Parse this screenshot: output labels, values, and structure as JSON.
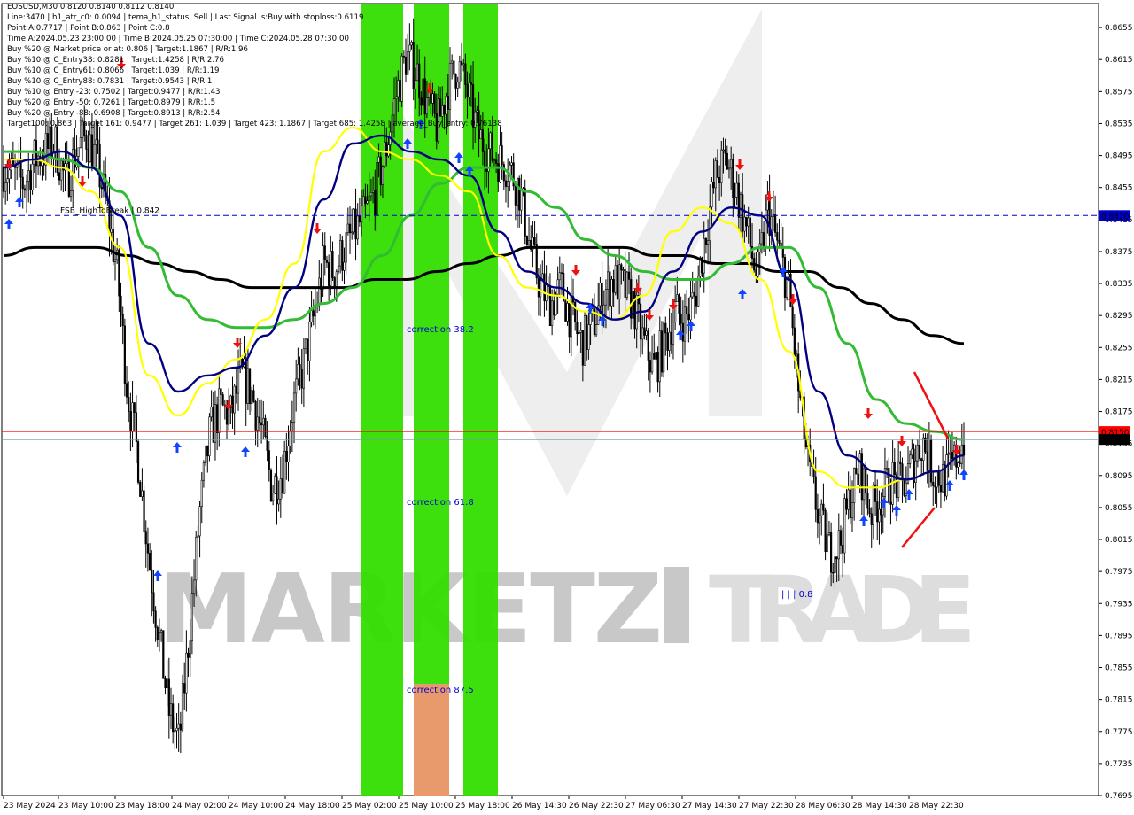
{
  "symbol_line": "EOSUSD,M30  0.8120 0.8140 0.8112 0.8140",
  "info_lines": [
    "Line:3470  |  h1_atr_c0: 0.0094  |  tema_h1_status: Sell  |  Last Signal is:Buy with stoploss:0.6119",
    "Point A:0.7717  |  Point B:0.863  |  Point C:0.8",
    "Time A:2024.05.23 23:00:00  |  Time B:2024.05.25 07:30:00  |  Time C:2024.05.28 07:30:00",
    "Buy %20 @ Market price or at: 0.806  |  Target:1.1867  |  R/R:1.96",
    "Buy %10 @ C_Entry38: 0.8281  |  Target:1.4258  |  R/R:2.76",
    "Buy %10 @ C_Entry61: 0.8066  |  Target:1.039  |  R/R:1.19",
    "Buy %10 @ C_Entry88: 0.7831  |  Target:0.9543  |  R/R:1",
    "Buy %10 @ Entry -23: 0.7502  |  Target:0.9477  |  R/R:1.43",
    "Buy %20 @ Entry -50: 0.7261  |  Target:0.8979  |  R/R:1.5",
    "Buy %20 @ Entry -88: 0.6908  |  Target:0.8913  |  R/R:2.54",
    "Target100: 0.863  |  Target 161: 0.9477  |  Target 261: 1.039  |  Target 423: 1.1867  |  Target 685: 1.4258  |  average_Buy_entry: 0.76138"
  ],
  "fsb_label": "FSB_HighToBreak | 0.842",
  "corrections": [
    "correction 38.2",
    "correction 61.8",
    "correction 87.5"
  ],
  "wave_label": "| | | 0.8",
  "watermark": {
    "left": "MARKETZ",
    "i": "I",
    "right": "TRADE"
  },
  "price_badges": {
    "fsb": "0.8420",
    "red": "0.8150",
    "current": "0.8140"
  },
  "colors": {
    "up": "#000000",
    "down": "#000000",
    "ma_black": "#000000",
    "ma_green": "#33bb33",
    "ma_navy": "#000080",
    "ma_yellow": "#ffff00",
    "fsb_line": "#0000cc",
    "red_line": "#ff0000",
    "band_green": "#33dd00",
    "band_orange": "#e89a6c"
  },
  "chart_data": {
    "type": "candlestick",
    "title": "EOSUSD,M30",
    "y_ticks": [
      "0.8655",
      "0.8615",
      "0.8575",
      "0.8535",
      "0.8495",
      "0.8455",
      "0.8415",
      "0.8375",
      "0.8335",
      "0.8295",
      "0.8255",
      "0.8215",
      "0.8175",
      "0.8135",
      "0.8095",
      "0.8055",
      "0.8015",
      "0.7975",
      "0.7935",
      "0.7895",
      "0.7855",
      "0.7815",
      "0.7775",
      "0.7735",
      "0.7695"
    ],
    "x_ticks": [
      "23 May 2024",
      "23 May 10:00",
      "23 May 18:00",
      "24 May 02:00",
      "24 May 10:00",
      "24 May 18:00",
      "25 May 02:00",
      "25 May 10:00",
      "25 May 18:00",
      "26 May 14:30",
      "26 May 22:30",
      "27 May 06:30",
      "27 May 14:30",
      "27 May 22:30",
      "28 May 06:30",
      "28 May 14:30",
      "28 May 22:30"
    ],
    "ylim": [
      0.7695,
      0.8685
    ],
    "levels": {
      "fsb_high_to_break": 0.842,
      "red_level": 0.815,
      "current": 0.814
    },
    "close_path": [
      0.848,
      0.847,
      0.846,
      0.849,
      0.85,
      0.851,
      0.846,
      0.85,
      0.852,
      0.849,
      0.843,
      0.835,
      0.82,
      0.812,
      0.8,
      0.79,
      0.78,
      0.776,
      0.79,
      0.805,
      0.815,
      0.818,
      0.817,
      0.822,
      0.82,
      0.815,
      0.808,
      0.81,
      0.818,
      0.823,
      0.829,
      0.836,
      0.835,
      0.838,
      0.84,
      0.842,
      0.845,
      0.85,
      0.857,
      0.862,
      0.86,
      0.856,
      0.853,
      0.858,
      0.861,
      0.857,
      0.852,
      0.85,
      0.849,
      0.848,
      0.845,
      0.838,
      0.833,
      0.831,
      0.833,
      0.829,
      0.826,
      0.828,
      0.832,
      0.834,
      0.833,
      0.831,
      0.826,
      0.823,
      0.826,
      0.83,
      0.829,
      0.832,
      0.84,
      0.847,
      0.849,
      0.845,
      0.84,
      0.834,
      0.843,
      0.838,
      0.833,
      0.82,
      0.81,
      0.804,
      0.8,
      0.801,
      0.807,
      0.81,
      0.805,
      0.807,
      0.809,
      0.808,
      0.811,
      0.814,
      0.81,
      0.809,
      0.811,
      0.814
    ],
    "ma_black": [
      0.837,
      0.838,
      0.838,
      0.838,
      0.837,
      0.836,
      0.835,
      0.834,
      0.833,
      0.833,
      0.833,
      0.833,
      0.834,
      0.834,
      0.835,
      0.836,
      0.837,
      0.838,
      0.838,
      0.838,
      0.838,
      0.837,
      0.837,
      0.836,
      0.836,
      0.835,
      0.835,
      0.833,
      0.831,
      0.829,
      0.827,
      0.826
    ],
    "ma_green": [
      0.85,
      0.85,
      0.849,
      0.848,
      0.845,
      0.838,
      0.832,
      0.829,
      0.828,
      0.828,
      0.829,
      0.831,
      0.833,
      0.837,
      0.842,
      0.846,
      0.848,
      0.848,
      0.845,
      0.843,
      0.839,
      0.837,
      0.835,
      0.834,
      0.834,
      0.836,
      0.838,
      0.838,
      0.833,
      0.826,
      0.819,
      0.816,
      0.815,
      0.814
    ],
    "ma_navy": [
      0.848,
      0.849,
      0.85,
      0.848,
      0.842,
      0.826,
      0.82,
      0.822,
      0.823,
      0.827,
      0.833,
      0.844,
      0.851,
      0.852,
      0.85,
      0.849,
      0.847,
      0.84,
      0.835,
      0.833,
      0.831,
      0.829,
      0.83,
      0.835,
      0.84,
      0.843,
      0.842,
      0.834,
      0.82,
      0.812,
      0.81,
      0.809,
      0.81,
      0.812
    ],
    "ma_yellow": [
      0.849,
      0.849,
      0.848,
      0.845,
      0.838,
      0.822,
      0.817,
      0.821,
      0.824,
      0.829,
      0.836,
      0.85,
      0.853,
      0.85,
      0.849,
      0.847,
      0.845,
      0.837,
      0.833,
      0.832,
      0.83,
      0.829,
      0.832,
      0.84,
      0.843,
      0.841,
      0.834,
      0.825,
      0.81,
      0.808,
      0.808,
      0.809,
      0.81,
      0.812
    ],
    "bands": [
      {
        "label": "correction 38.2"
      },
      {
        "label": "correction 61.8"
      },
      {
        "label": "correction 87.5"
      }
    ]
  }
}
